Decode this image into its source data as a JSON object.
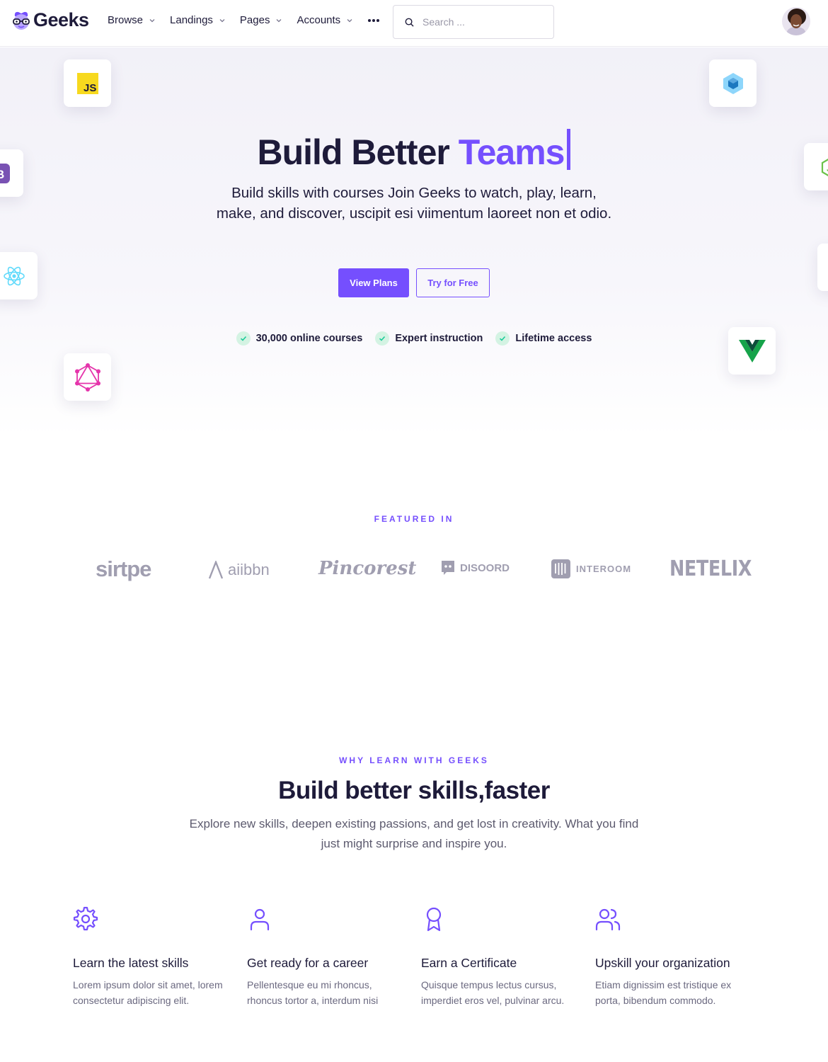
{
  "brand": {
    "name": "Geeks"
  },
  "nav": {
    "items": [
      {
        "label": "Browse"
      },
      {
        "label": "Landings"
      },
      {
        "label": "Pages"
      },
      {
        "label": "Accounts"
      }
    ],
    "more_icon": "more-horizontal-icon"
  },
  "search": {
    "placeholder": "Search ...",
    "value": ""
  },
  "hero": {
    "title_main": "Build Better",
    "title_accent": "Teams",
    "subtitle": "Build skills with courses Join Geeks to watch, play, learn, make, and discover, uscipit esi viimentum laoreet non et odio.",
    "primary_button": "View Plans",
    "secondary_button": "Try for Free",
    "checks": [
      {
        "label": "30,000 online courses"
      },
      {
        "label": "Expert instruction"
      },
      {
        "label": "Lifetime access"
      }
    ],
    "floating_icons": [
      "javascript-icon",
      "webpack-icon",
      "bootstrap-icon",
      "nodejs-icon",
      "react-icon",
      "vue-icon",
      "graphql-icon"
    ]
  },
  "featured": {
    "eyebrow": "FEATURED IN",
    "logos": [
      "sirtpe",
      "aiibbn",
      "Pincorest",
      "DISOORD",
      "INTEROOM",
      "NETELIX"
    ]
  },
  "why": {
    "eyebrow": "WHY LEARN WITH GEEKS",
    "title": "Build better skills,faster",
    "subtitle": "Explore new skills, deepen existing passions, and get lost in creativity. What you find just might surprise and inspire you.",
    "features": [
      {
        "icon": "settings-icon",
        "title": "Learn the latest skills",
        "desc": "Lorem ipsum dolor sit amet, lorem consectetur adipiscing elit."
      },
      {
        "icon": "user-icon",
        "title": "Get ready for a career",
        "desc": "Pellentesque eu mi rhoncus, rhoncus tortor a, interdum nisi"
      },
      {
        "icon": "award-icon",
        "title": "Earn a Certificate",
        "desc": "Quisque tempus lectus cursus, imperdiet eros vel, pulvinar arcu."
      },
      {
        "icon": "users-icon",
        "title": "Upskill your organization",
        "desc": "Etiam dignissim est tristique ex porta, bibendum commodo."
      }
    ]
  },
  "colors": {
    "accent": "#754ffe",
    "text": "#1e1b3a",
    "muted": "#6b6980",
    "check_bg": "#d4f3e3",
    "check_fg": "#19cb98"
  }
}
